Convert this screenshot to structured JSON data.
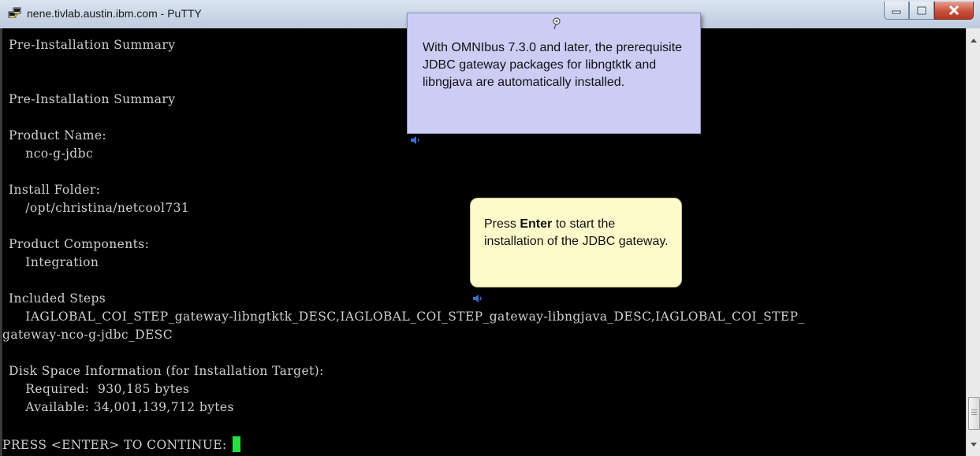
{
  "window": {
    "title": "nene.tivlab.austin.ibm.com - PuTTY",
    "buttons": [
      "minimize",
      "maximize",
      "close"
    ]
  },
  "terminal": {
    "lines": [
      "Pre-Installation Summary",
      "Pre-Installation Summary",
      "Product Name:",
      "    nco-g-jdbc",
      "Install Folder:",
      "    /opt/christina/netcool731",
      "Product Components:",
      "    Integration",
      "Included Steps",
      "    IAGLOBAL_COI_STEP_gateway-libngtktk_DESC,IAGLOBAL_COI_STEP_gateway-libngjava_DESC,IAGLOBAL_COI_STEP_",
      "gateway-nco-g-jdbc_DESC",
      "Disk Space Information (for Installation Target):",
      "    Required:  930,185 bytes",
      "    Available: 34,001,139,712 bytes",
      "PRESS <ENTER> TO CONTINUE: "
    ],
    "cursor_color": "#22e040"
  },
  "callouts": {
    "note": "With OMNIbus 7.3.0 and later, the prerequisite JDBC gateway packages for libngtktk and libngjava are automatically installed.",
    "instruction_prefix": "Press ",
    "instruction_key": "Enter",
    "instruction_suffix": " to start the installation of the JDBC gateway."
  },
  "colors": {
    "terminal_bg": "#000000",
    "terminal_fg": "#cfcfcf",
    "note_bg": "#ccccf5",
    "instruction_bg": "#fdfbc9",
    "close_button": "#c9513c"
  },
  "icons": [
    "putty-icon",
    "minimize-icon",
    "maximize-icon",
    "close-icon",
    "pin-icon",
    "speaker-icon",
    "scroll-up-icon",
    "scroll-down-icon"
  ]
}
